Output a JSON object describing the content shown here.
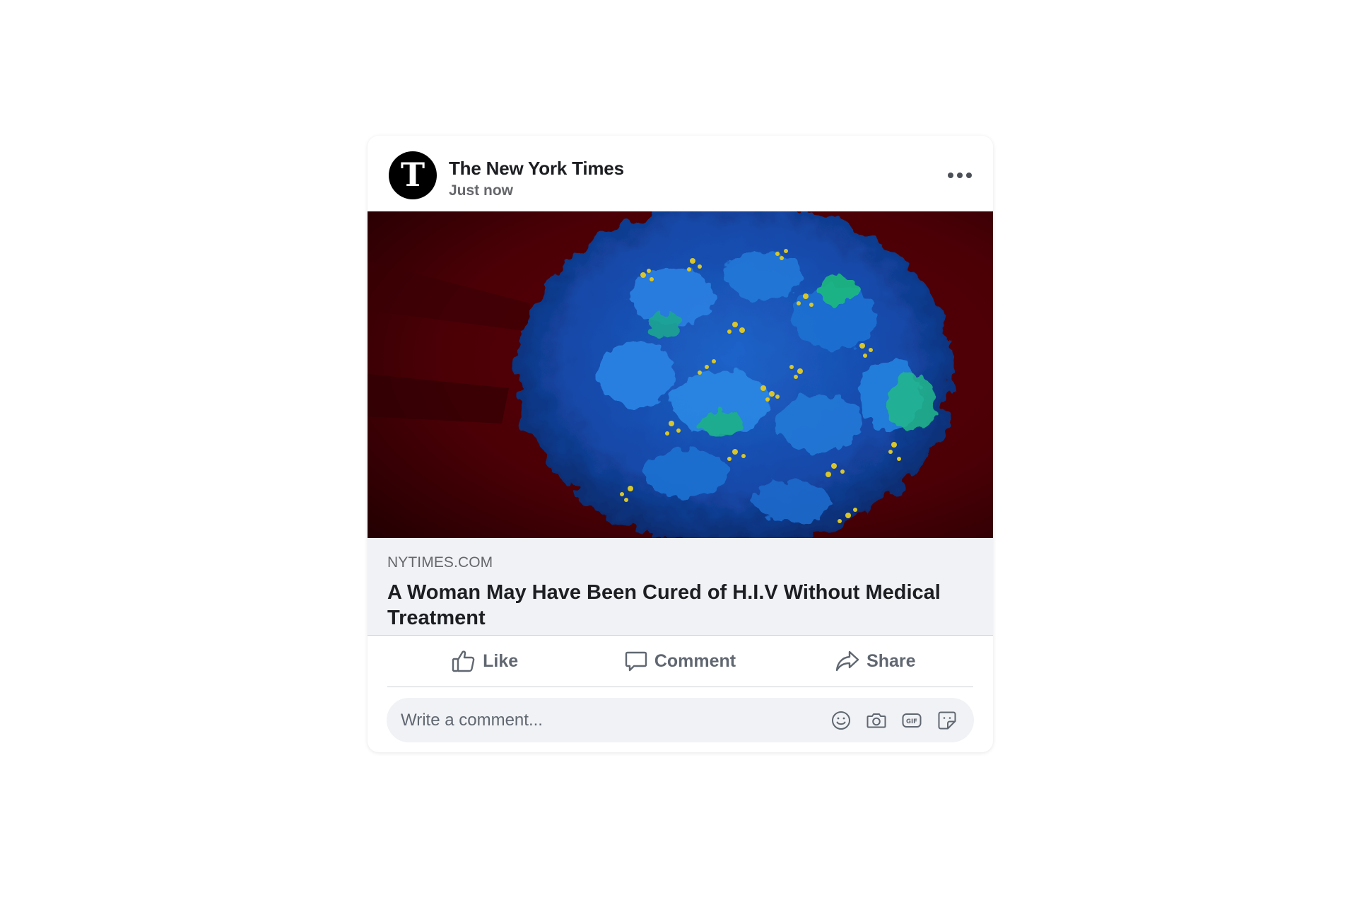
{
  "post": {
    "page_name": "The New York Times",
    "timestamp": "Just now",
    "avatar_letter": "T",
    "avatar_icon": "nyt-logo-icon",
    "menu_icon": "more-options-icon"
  },
  "link_preview": {
    "domain": "NYTIMES.COM",
    "title": "A Woman May Have Been Cured of H.I.V Without Medical Treatment",
    "image_icon": "hiv-cell-micrograph-image"
  },
  "actions": {
    "like_label": "Like",
    "comment_label": "Comment",
    "share_label": "Share"
  },
  "comment": {
    "placeholder": "Write a comment...",
    "tools": [
      "emoji-icon",
      "camera-icon",
      "gif-icon",
      "sticker-icon"
    ]
  },
  "colors": {
    "text_primary": "#1c1e21",
    "text_secondary": "#65676b",
    "preview_background": "#f0f2f5",
    "image_background": "#4a0005"
  }
}
